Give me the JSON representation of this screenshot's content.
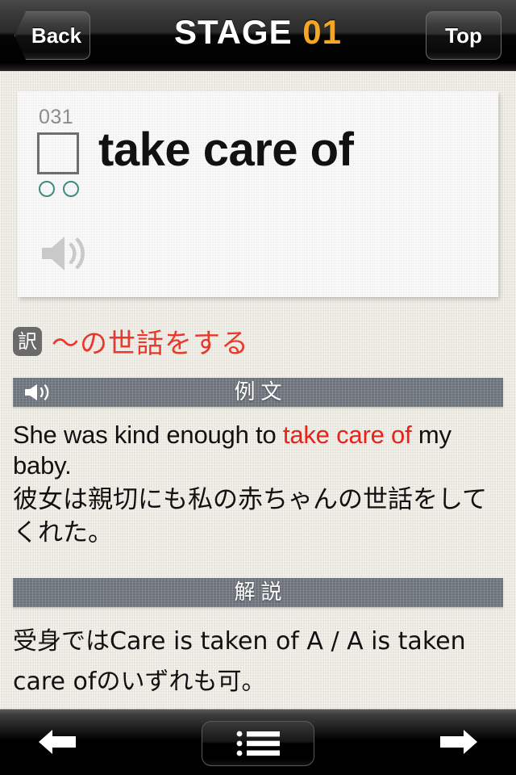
{
  "navbar": {
    "back_label": "Back",
    "title_prefix": "STAGE",
    "title_number": "01",
    "top_label": "Top",
    "accent_color": "#f5a623"
  },
  "card": {
    "number": "031",
    "headword": "take care of",
    "checkbox_checked": false,
    "progress_dots": 2,
    "dot_color": "#3f8b7c",
    "speaker_icon": "speaker-icon"
  },
  "translation": {
    "badge_label": "訳",
    "text": "〜の世話をする",
    "text_color": "#e8392c"
  },
  "sections": [
    {
      "id": "example",
      "bar_title": "例文",
      "has_speaker": true,
      "english_before": "She was kind enough to ",
      "english_keyword": "take care of",
      "english_after": " my baby.",
      "japanese": "彼女は親切にも私の赤ちゃんの世話をしてくれた。"
    },
    {
      "id": "commentary",
      "bar_title": "解説",
      "has_speaker": false,
      "text": "受身ではCare is taken of A / A is taken care ofのいずれも可。"
    }
  ],
  "toolbar": {
    "prev_label": "arrow-left-icon",
    "list_label": "list-icon",
    "next_label": "arrow-right-icon"
  }
}
